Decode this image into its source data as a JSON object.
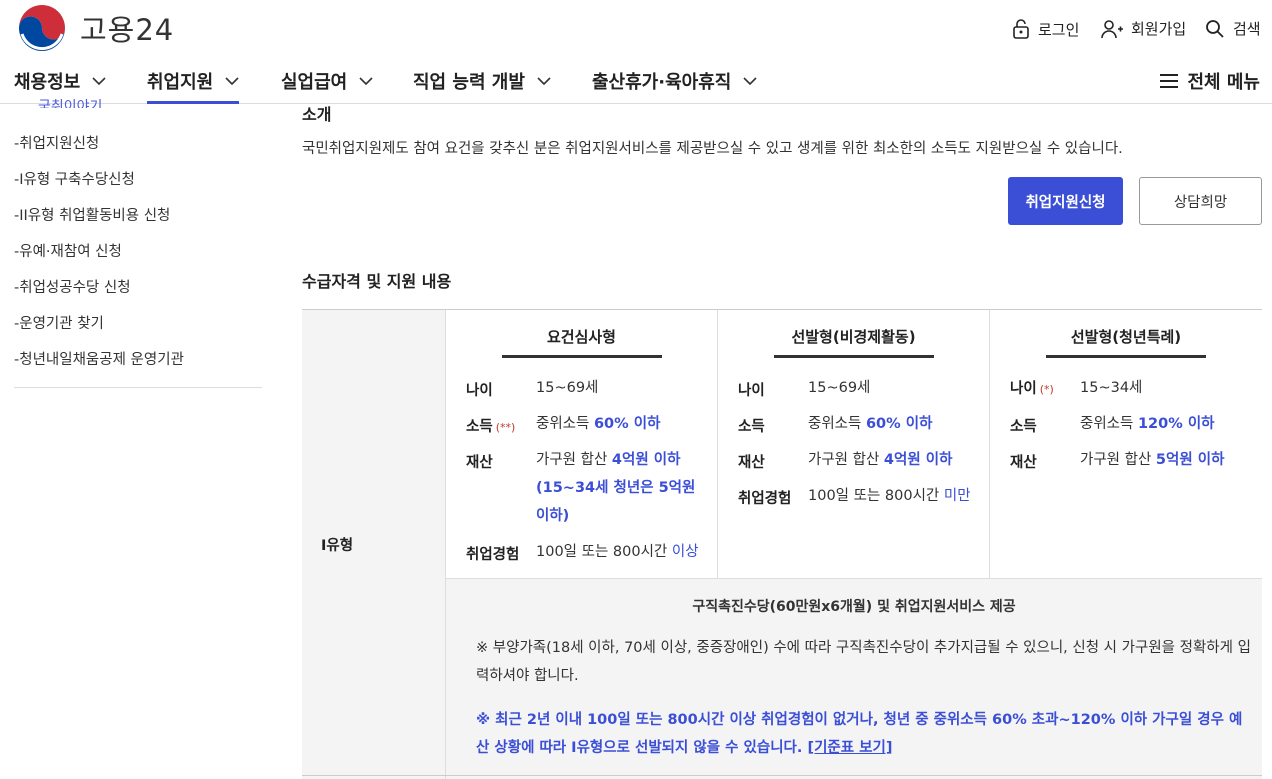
{
  "brand": {
    "name": "고용24"
  },
  "util": {
    "login": "로그인",
    "signup": "회원가입",
    "search": "검색"
  },
  "gnb": [
    {
      "label": "채용정보"
    },
    {
      "label": "취업지원"
    },
    {
      "label": "실업급여"
    },
    {
      "label": "직업 능력 개발"
    },
    {
      "label": "출산휴가·육아휴직"
    }
  ],
  "allmenu": "전체 메뉴",
  "sidebar": {
    "cut_item": "국취이야기",
    "items": [
      "-취업지원신청",
      "-I유형 구축수당신청",
      "-II유형 취업활동비용 신청",
      "-유예·재참여 신청",
      "-취업성공수당 신청",
      "-운영기관 찾기",
      "-청년내일채움공제 운영기관"
    ]
  },
  "intro": {
    "heading": "소개",
    "text": "국민취업지원제도 참여 요건을 갖추신 분은 취업지원서비스를 제공받으실 수 있고 생계를 위한 최소한의 소득도 지원받으실 수 있습니다.",
    "apply_button": "취업지원신청",
    "consult_button": "상담희망"
  },
  "eligibility": {
    "heading": "수급자격 및 지원 내용",
    "row_label": "I유형",
    "columns": [
      {
        "title": "요건심사형",
        "rows": [
          {
            "k": "나이",
            "v": "15~69세"
          },
          {
            "k": "소득",
            "mark": "(**)",
            "v1": "중위소득 ",
            "hl": "60% 이하"
          },
          {
            "k": "재산",
            "v1": "가구원 합산 ",
            "hl": "4억원 이하",
            "hl2": "(15~34세 청년은 5억원 이하)"
          },
          {
            "k": "취업경험",
            "v1": "100일 또는 800시간 ",
            "hl": "이상"
          }
        ]
      },
      {
        "title": "선발형(비경제활동)",
        "rows": [
          {
            "k": "나이",
            "v": "15~69세"
          },
          {
            "k": "소득",
            "v1": "중위소득 ",
            "hl": "60% 이하"
          },
          {
            "k": "재산",
            "v1": "가구원 합산 ",
            "hl": "4억원 이하"
          },
          {
            "k": "취업경험",
            "v1": "100일 또는 800시간 ",
            "hl": "미만"
          }
        ]
      },
      {
        "title": "선발형(청년특례)",
        "rows": [
          {
            "k": "나이",
            "mark": "(*)",
            "v": "15~34세"
          },
          {
            "k": "소득",
            "v1": "중위소득 ",
            "hl": "120% 이하"
          },
          {
            "k": "재산",
            "v1": "가구원 합산 ",
            "hl": "5억원 이하"
          }
        ]
      }
    ],
    "support": "구직촉진수당(60만원x6개월) 및 취업지원서비스 제공",
    "note1": "※ 부양가족(18세 이하, 70세 이상, 중증장애인) 수에 따라 구직촉진수당이 추가지급될 수 있으니, 신청 시 가구원을 정확하게 입력하셔야 합니다.",
    "note2": "※ 최근 2년 이내 100일 또는 800시간 이상 취업경험이 없거나, 청년 중 중위소득 60% 초과~120% 이하 가구일 경우 예산 상황에 따라 I유형으로 선발되지 않을 수 있습니다.",
    "note2_link": "[기준표 보기]"
  },
  "colors": {
    "accent": "#3b4fd6",
    "required": "#c0392b",
    "panel": "#f4f4f4"
  }
}
